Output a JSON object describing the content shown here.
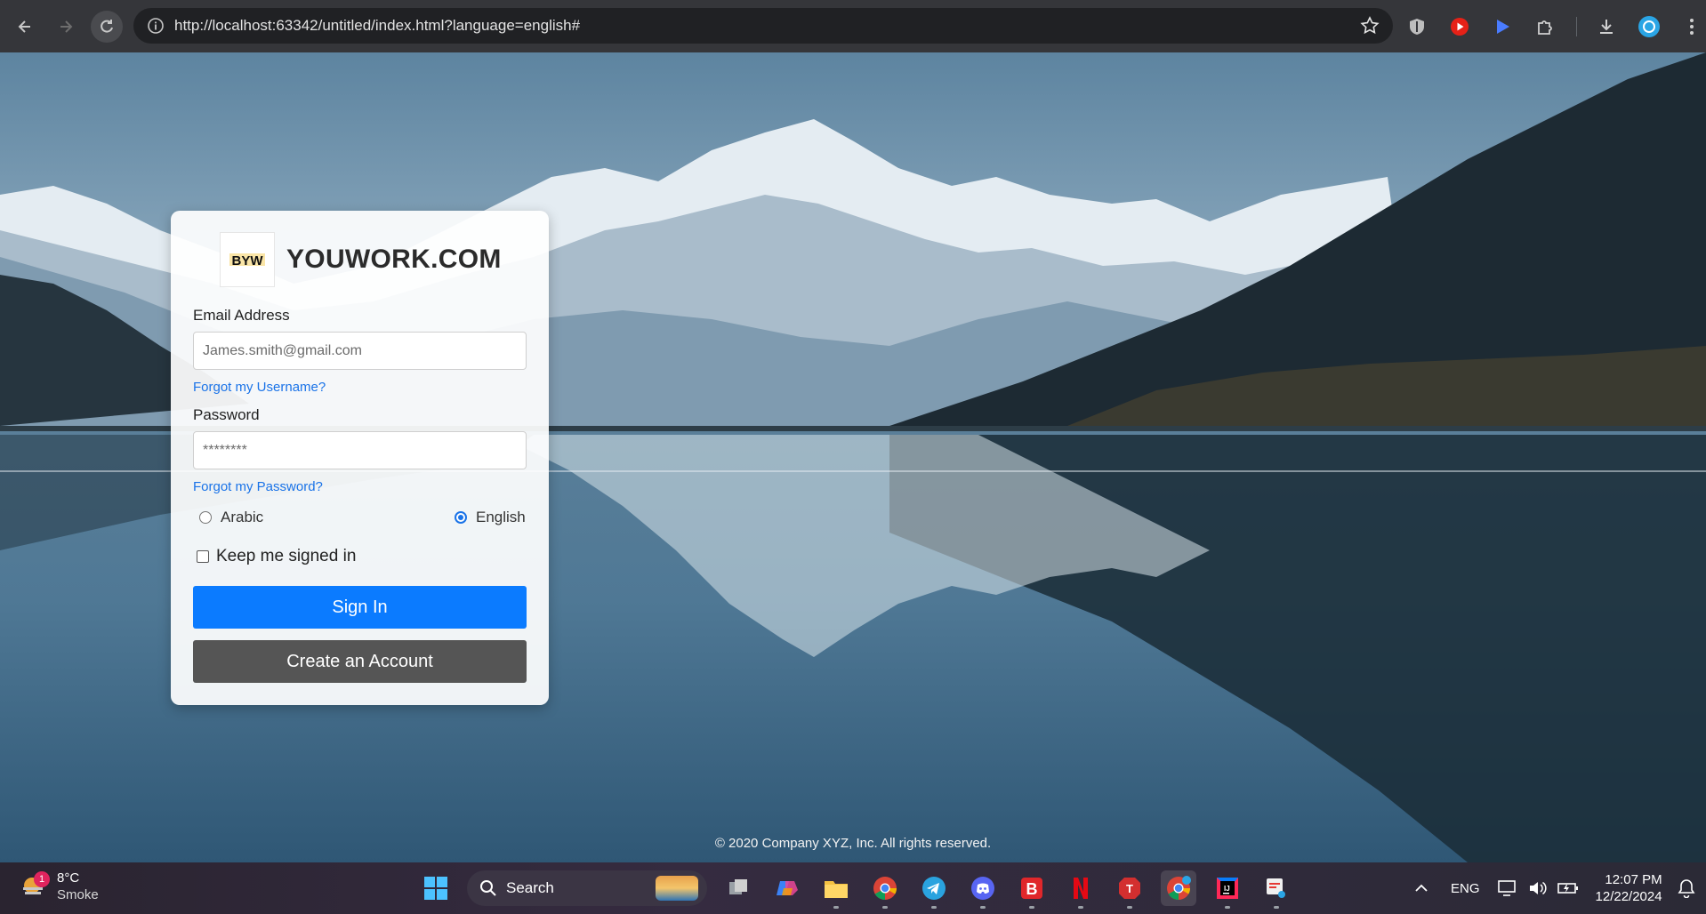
{
  "browser": {
    "url": "http://localhost:63342/untitled/index.html?language=english#"
  },
  "login": {
    "brand_name": "YOUWORK.COM",
    "logo_text": "BYW",
    "email_label": "Email Address",
    "email_placeholder": "James.smith@gmail.com",
    "forgot_username": "Forgot my Username?",
    "password_label": "Password",
    "password_placeholder": "********",
    "forgot_password": "Forgot my Password?",
    "language_options": [
      {
        "label": "Arabic",
        "checked": false
      },
      {
        "label": "English",
        "checked": true
      }
    ],
    "keep_signed_in": "Keep me signed in",
    "sign_in": "Sign In",
    "create_account": "Create an Account"
  },
  "footer": {
    "copyright": "© 2020 Company XYZ, Inc. All rights reserved."
  },
  "taskbar": {
    "weather_temp": "8°C",
    "weather_condition": "Smoke",
    "weather_badge": "1",
    "search_label": "Search",
    "language": "ENG",
    "time": "12:07 PM",
    "date": "12/22/2024"
  },
  "colors": {
    "primary_button": "#0b7bff",
    "secondary_button": "#555555",
    "link": "#1a73e8"
  }
}
